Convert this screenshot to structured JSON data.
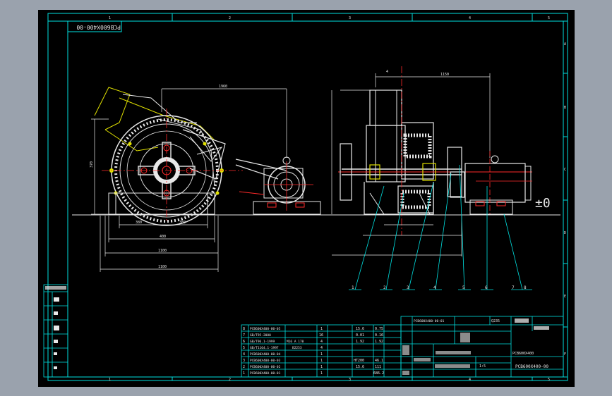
{
  "drawing": {
    "title_rotated": "PCB600X400-00",
    "ground_symbol": "±0",
    "zone_numbers_top": [
      "1",
      "2",
      "3",
      "4",
      "5"
    ],
    "zone_numbers_bottom": [
      "1",
      "2",
      "3",
      "4",
      "5"
    ],
    "zone_letters_right": [
      "A",
      "B",
      "C",
      "D",
      "E",
      "F"
    ],
    "dimension_labels": [
      "1960",
      "370",
      "4",
      "380",
      "380",
      "400",
      "1100",
      "1100",
      "1150"
    ],
    "balloons": [
      "1",
      "2",
      "3",
      "4",
      "5",
      "6",
      "7",
      "8"
    ]
  },
  "parts_list": {
    "rows": [
      [
        "8",
        "PCB600X400-00-05",
        "",
        "1",
        "15.6",
        "0.75"
      ],
      [
        "7",
        "GB/T95-2000",
        "",
        "16",
        "0.01",
        "0.16"
      ],
      [
        "6",
        "GB/T96.1-1999",
        "M16 A 170",
        "4",
        "1.92",
        "1.92"
      ],
      [
        "5",
        "GB/T1164.1-1997",
        "B2253",
        "4",
        "",
        ""
      ],
      [
        "4",
        "PCB600X400-00-04",
        "",
        "1",
        "",
        ""
      ],
      [
        "3",
        "PCB600X400-00-03",
        "",
        "1",
        "HT200",
        "46.1"
      ],
      [
        "2",
        "PCB600X400-00-02",
        "",
        "1",
        "15.6",
        "111"
      ],
      [
        "1",
        "PCB600X400-00-01",
        "",
        "1",
        "",
        "686.2"
      ]
    ]
  },
  "title_block": {
    "header_code": "PCB600X400-00-01",
    "q235": "Q235",
    "model": "PCB600X400",
    "drawing_no": "PCB600X400-00",
    "scale": "1:5"
  }
}
